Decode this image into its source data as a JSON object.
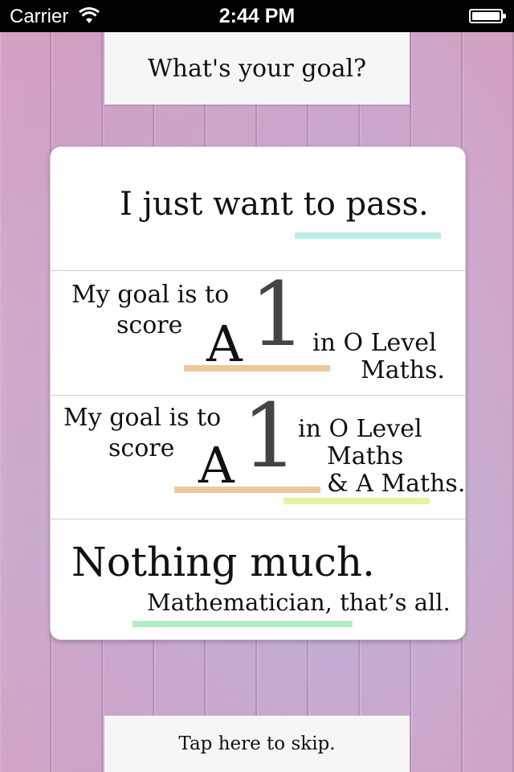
{
  "statusbar": {
    "carrier": "Carrier",
    "time": "2:44 PM"
  },
  "header": {
    "title": "What's your goal?"
  },
  "options": [
    {
      "text": "I just want to pass."
    },
    {
      "line1": "My goal is to",
      "line2": "score",
      "grade_letter": "A",
      "grade_number": "1",
      "suffix1": "in O Level",
      "suffix2": "Maths."
    },
    {
      "line1": "My goal is to",
      "line2": "score",
      "grade_letter": "A",
      "grade_number": "1",
      "suffix1": "in O Level",
      "suffix2": "Maths",
      "suffix3": "& A Maths."
    },
    {
      "title": "Nothing much.",
      "subtitle": "Mathematician, that’s all."
    }
  ],
  "skip": {
    "label": "Tap here to skip."
  },
  "colors": {
    "underline_cyan": "#bdeee9",
    "underline_orange": "#ecc89f",
    "underline_yellow": "#e9f2a0",
    "underline_green": "#b5ecc7"
  }
}
